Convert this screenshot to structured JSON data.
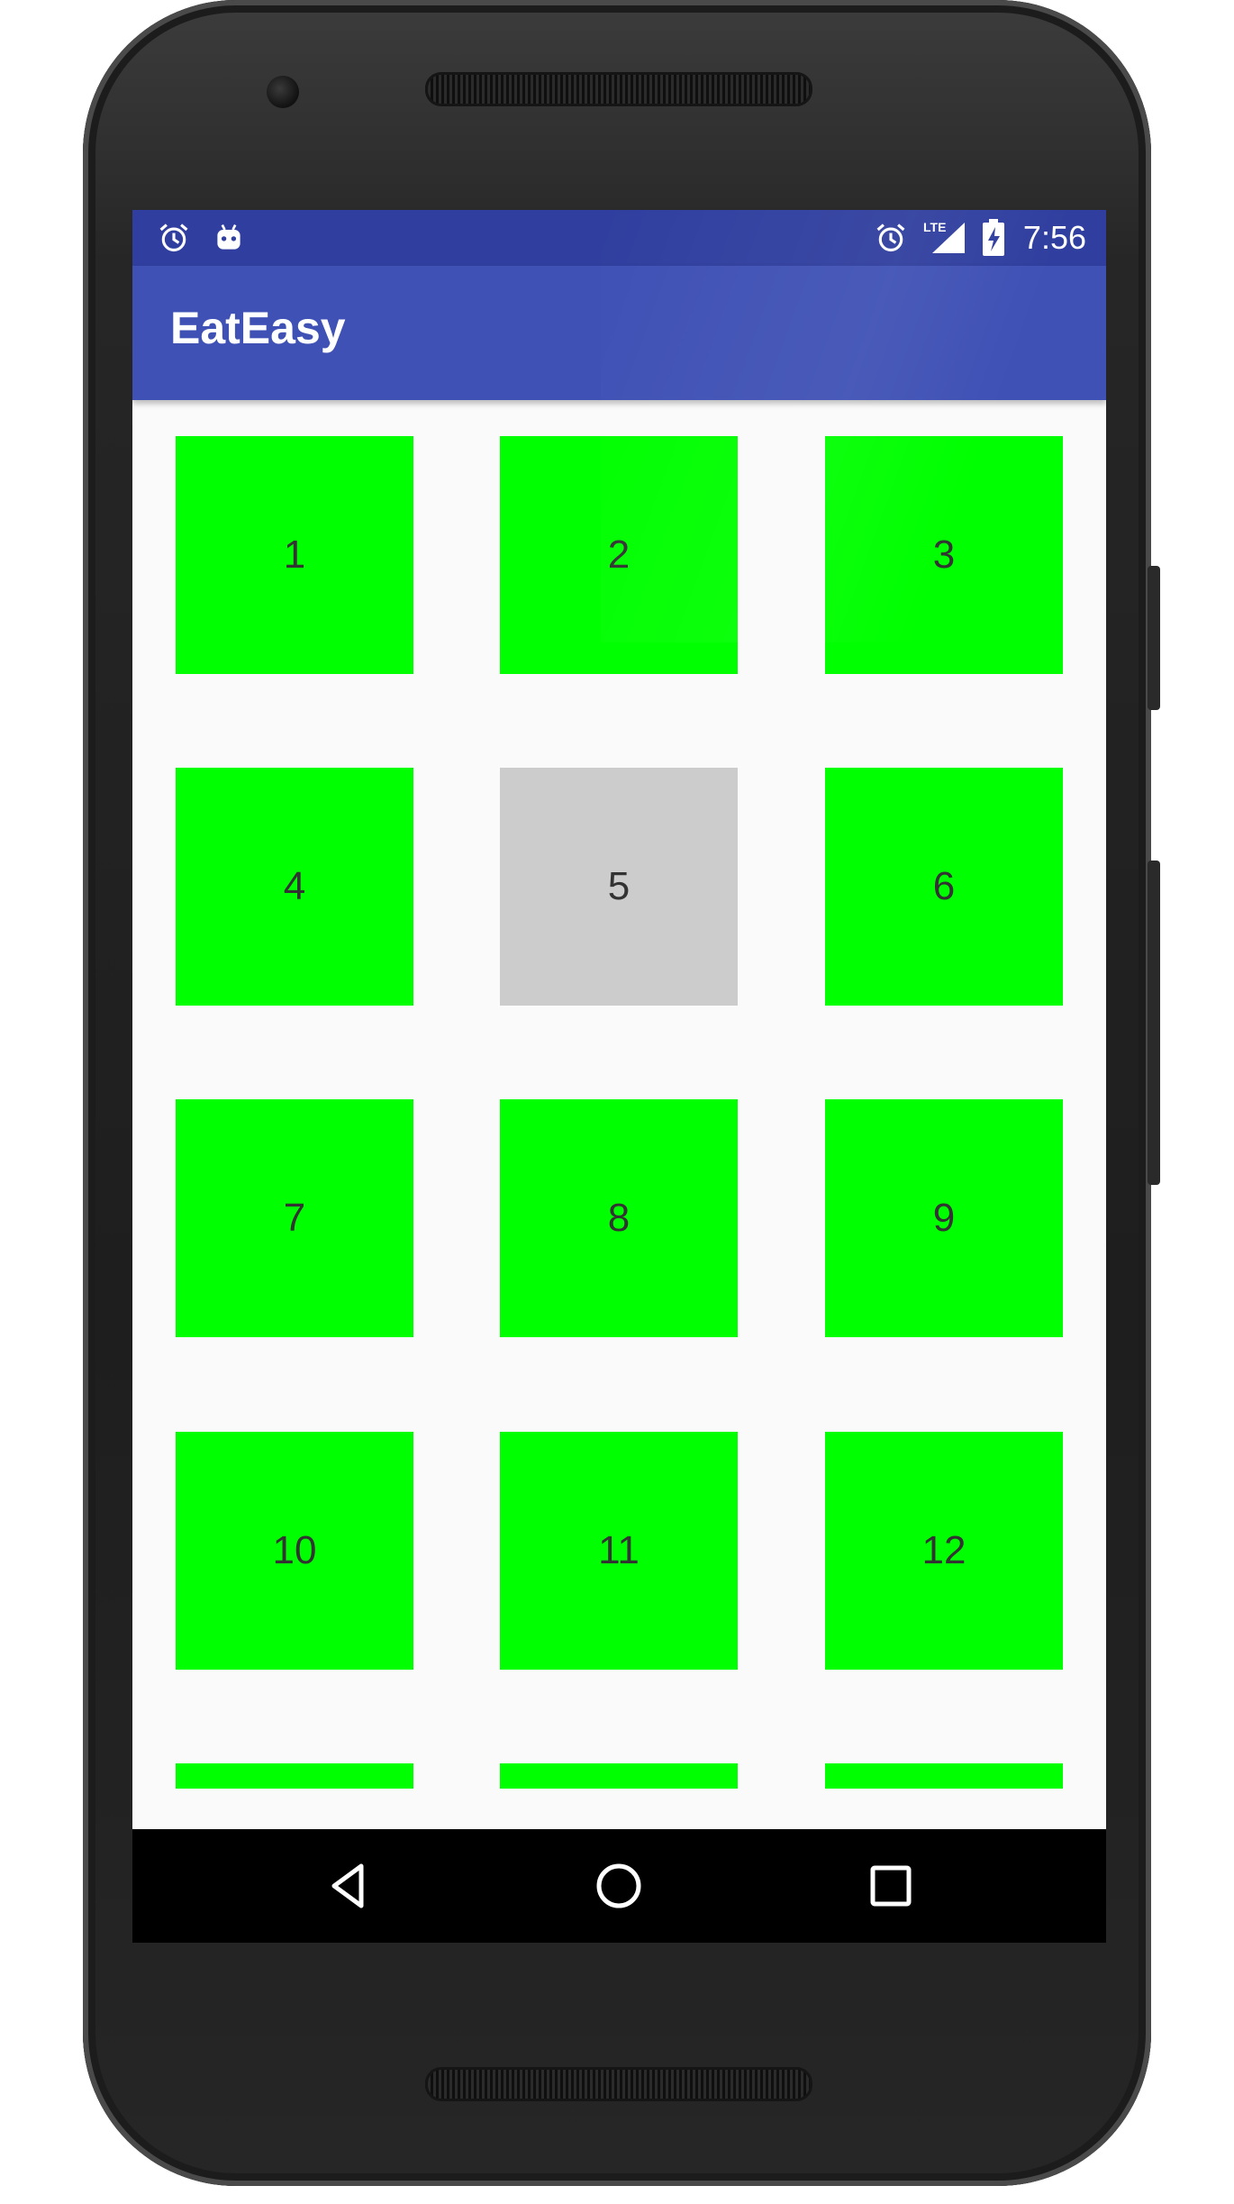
{
  "status_bar": {
    "time": "7:56",
    "left_icons": [
      "alarm-icon",
      "android-debug-icon"
    ],
    "right_icons": [
      "alarm-icon",
      "lte-signal-icon",
      "battery-charging-icon"
    ],
    "network_label": "LTE",
    "background": "#303f9f"
  },
  "app_bar": {
    "title": "EatEasy",
    "background": "#3f51b5"
  },
  "grid": {
    "tiles": [
      {
        "label": "1",
        "color": "#00ff00"
      },
      {
        "label": "2",
        "color": "#00ff00"
      },
      {
        "label": "3",
        "color": "#00ff00"
      },
      {
        "label": "4",
        "color": "#00ff00"
      },
      {
        "label": "5",
        "color": "#cccccc"
      },
      {
        "label": "6",
        "color": "#00ff00"
      },
      {
        "label": "7",
        "color": "#00ff00"
      },
      {
        "label": "8",
        "color": "#00ff00"
      },
      {
        "label": "9",
        "color": "#00ff00"
      },
      {
        "label": "10",
        "color": "#00ff00"
      },
      {
        "label": "11",
        "color": "#00ff00"
      },
      {
        "label": "12",
        "color": "#00ff00"
      }
    ],
    "partial_row_count": 3
  },
  "nav_bar": {
    "buttons": [
      "back-icon",
      "home-icon",
      "recents-icon"
    ]
  }
}
